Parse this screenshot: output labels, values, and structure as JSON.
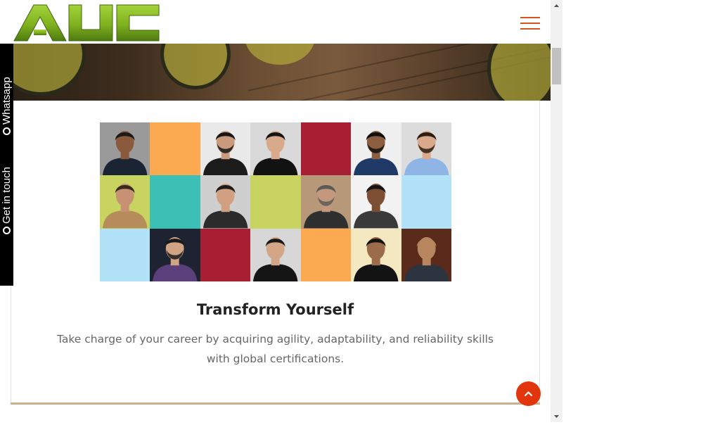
{
  "header": {
    "logo_text": "AUC",
    "menu_icon": "hamburger-menu-icon"
  },
  "side_tab": {
    "whatsapp_label": "Whatsapp",
    "get_in_touch_label": "Get in touch",
    "whatsapp_icon": "whatsapp-icon",
    "chat_icon": "chat-icon"
  },
  "colors": {
    "accent": "#e3350c",
    "menu": "#d2541f",
    "logo_green": "#7fb11f",
    "tile_orange": "#fbaa51",
    "tile_red": "#a81e32",
    "tile_teal": "#3cc0b5",
    "tile_lime": "#c9d35f",
    "tile_sky": "#b2e2f7",
    "card_rule": "#c9b18f"
  },
  "main": {
    "title": "Transform Yourself",
    "description": "Take charge of your career by acquiring agility, adaptability, and reliability skills with global certifications."
  },
  "grid_tiles": [
    {
      "kind": "person",
      "bg": "#9a9a9a",
      "skin": "#8a5a3c",
      "hair": "#1a1a1a",
      "suit": "#1b2432",
      "beard": false
    },
    {
      "kind": "color",
      "bg": "#fbaa51"
    },
    {
      "kind": "person",
      "bg": "#e9e9e9",
      "skin": "#c99a7c",
      "hair": "#161616",
      "suit": "#1c1c1c",
      "beard": true
    },
    {
      "kind": "person",
      "bg": "#d9d9d9",
      "skin": "#d8a98a",
      "hair": "#141414",
      "suit": "#121212",
      "beard": false
    },
    {
      "kind": "color",
      "bg": "#a81e32"
    },
    {
      "kind": "person",
      "bg": "#f0f0f0",
      "skin": "#8c5e40",
      "hair": "#101010",
      "suit": "#1f3a66",
      "beard": true
    },
    {
      "kind": "person",
      "bg": "#dcdcdc",
      "skin": "#d8a98a",
      "hair": "#2a1d12",
      "suit": "#8fb5e6",
      "beard": true
    },
    {
      "kind": "person",
      "bg": "#c9d35f",
      "skin": "#c79173",
      "hair": "#3a2a1c",
      "suit": "#b68c5a",
      "beard": false
    },
    {
      "kind": "color",
      "bg": "#3cc0b5"
    },
    {
      "kind": "person",
      "bg": "#cfcfcf",
      "skin": "#d0a081",
      "hair": "#1c1c1c",
      "suit": "#2b2b2b",
      "beard": false
    },
    {
      "kind": "color",
      "bg": "#c9d35f"
    },
    {
      "kind": "person",
      "bg": "#b79878",
      "skin": "#c4987a",
      "hair": "#5a5a5a",
      "suit": "#2f2f2f",
      "beard": true
    },
    {
      "kind": "person",
      "bg": "#f2f2f2",
      "skin": "#7c4f33",
      "hair": "#141414",
      "suit": "#3a3a3a",
      "beard": false
    },
    {
      "kind": "color",
      "bg": "#b2e2f7"
    },
    {
      "kind": "color",
      "bg": "#b2e2f7"
    },
    {
      "kind": "person",
      "bg": "#1d2330",
      "skin": "#d2a486",
      "hair": "#1a1a1a",
      "suit": "#5a3f7a",
      "beard": true
    },
    {
      "kind": "color",
      "bg": "#a81e32"
    },
    {
      "kind": "person",
      "bg": "#d7d7d7",
      "skin": "#d3a687",
      "hair": "#1a1a1a",
      "suit": "#151515",
      "beard": false
    },
    {
      "kind": "color",
      "bg": "#fbaa51"
    },
    {
      "kind": "person",
      "bg": "#f4e8c0",
      "skin": "#9c6b4a",
      "hair": "#121212",
      "suit": "#131313",
      "beard": false
    },
    {
      "kind": "person",
      "bg": "#5a2a1a",
      "skin": "#b7865f",
      "hair": "#b7865f",
      "suit": "#2c3440",
      "beard": true
    }
  ]
}
